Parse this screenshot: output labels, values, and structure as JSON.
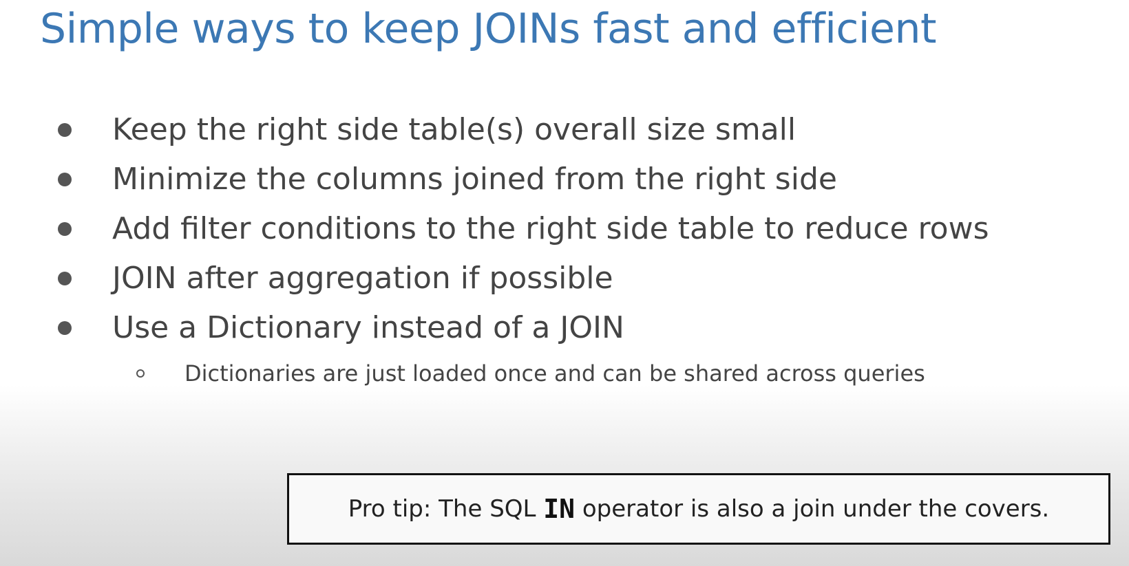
{
  "slide": {
    "title": "Simple ways to keep JOINs fast and efficient",
    "bullets": [
      "Keep the right side table(s) overall size small",
      "Minimize the columns joined from the right side",
      "Add filter conditions to the right side table to reduce rows",
      "JOIN after aggregation if possible",
      "Use a Dictionary instead of a JOIN"
    ],
    "sub_bullets": [
      "Dictionaries are just loaded once and can be shared across queries"
    ]
  },
  "pro_tip": {
    "prefix": "Pro tip: The SQL ",
    "code": "IN",
    "suffix": " operator is also a join under the covers."
  },
  "colors": {
    "title": "#3c78b4",
    "body_text": "#444444",
    "bullet": "#555555",
    "box_border": "#111111"
  }
}
